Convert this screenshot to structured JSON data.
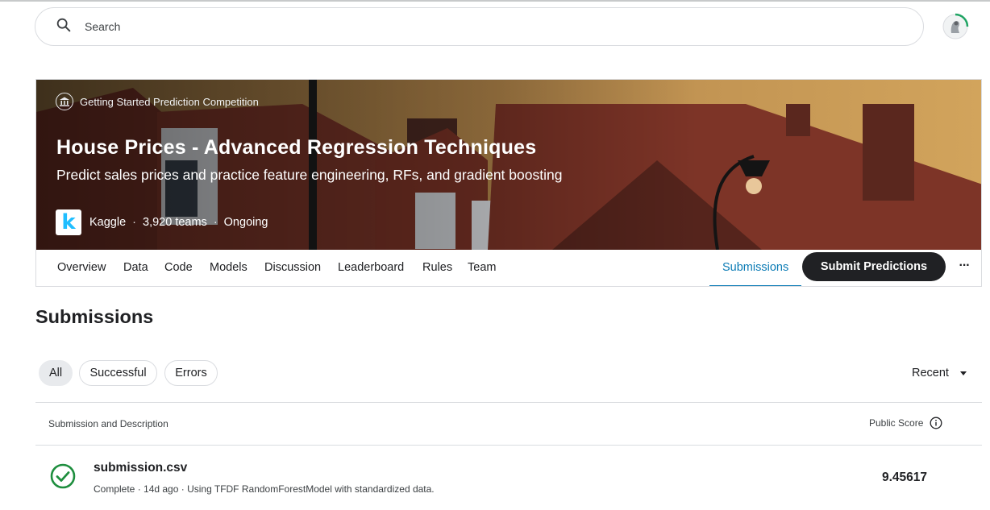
{
  "search": {
    "placeholder": "Search"
  },
  "competition": {
    "type_label": "Getting Started Prediction Competition",
    "title": "House Prices - Advanced Regression Techniques",
    "subtitle": "Predict sales prices and practice feature engineering, RFs, and gradient boosting",
    "host": "Kaggle",
    "host_logo_letter": "k",
    "teams": "3,920 teams",
    "status": "Ongoing",
    "separator": "·"
  },
  "tabs": [
    {
      "label": "Overview"
    },
    {
      "label": "Data"
    },
    {
      "label": "Code"
    },
    {
      "label": "Models"
    },
    {
      "label": "Discussion"
    },
    {
      "label": "Leaderboard"
    },
    {
      "label": "Rules"
    },
    {
      "label": "Team"
    }
  ],
  "active_tab": "Submissions",
  "submit_button": "Submit Predictions",
  "more_label": "···",
  "page_title": "Submissions",
  "filters": [
    {
      "label": "All",
      "active": true
    },
    {
      "label": "Successful",
      "active": false
    },
    {
      "label": "Errors",
      "active": false
    }
  ],
  "sort": {
    "selected": "Recent"
  },
  "table": {
    "col_description": "Submission and Description",
    "col_score": "Public Score",
    "rows": [
      {
        "filename": "submission.csv",
        "description": "Complete · 14d ago · Using TFDF RandomForestModel with standardized data.",
        "score": "9.45617",
        "status": "success"
      }
    ]
  },
  "colors": {
    "accent": "#0b7bb5",
    "success": "#1e8e3e",
    "dark_button": "#202124",
    "kaggle_blue": "#20beff"
  },
  "icons": {
    "search": "search-icon",
    "competition_type": "bank-icon",
    "info": "info-icon",
    "success": "check-circle-icon",
    "more": "more-horiz-icon",
    "sort": "caret-down-icon"
  }
}
